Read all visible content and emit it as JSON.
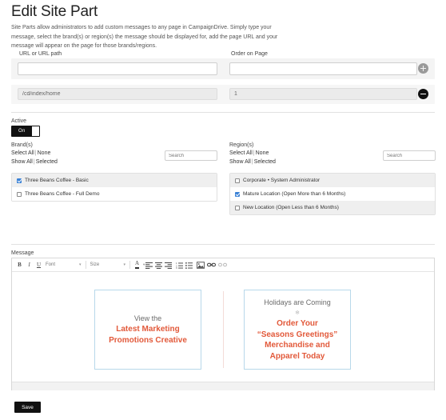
{
  "page": {
    "title": "Edit Site Part",
    "intro": "Site Parts allow administrators to add custom messages to any page in CampaignDrive. Simply type your message, select the brand(s) or region(s) the message should be displayed for, add the page URL and your message will appear on the page for those brands/regions."
  },
  "url_section": {
    "url_label": "URL or URL path",
    "order_label": "Order on Page",
    "new_row": {
      "url_value": "",
      "url_placeholder": "",
      "order_value": "",
      "order_placeholder": "",
      "add_icon": "plus-circle-icon"
    },
    "existing_row": {
      "url_value": "/cd/index/home",
      "order_value": "1",
      "remove_icon": "minus-circle-icon"
    }
  },
  "active": {
    "label": "Active",
    "state": "On"
  },
  "brands": {
    "title": "Brand(s)",
    "select_all": "Select All",
    "none": "None",
    "show_all": "Show All",
    "selected": "Selected",
    "separator": "|",
    "search_placeholder": "Search",
    "search_value": "",
    "items": [
      {
        "label": "Three Beans Coffee - Basic",
        "checked": true
      },
      {
        "label": "Three Beans Coffee - Full Demo",
        "checked": false
      }
    ]
  },
  "regions": {
    "title": "Region(s)",
    "select_all": "Select All",
    "none": "None",
    "show_all": "Show All",
    "selected": "Selected",
    "separator": "|",
    "search_placeholder": "Search",
    "search_value": "",
    "items": [
      {
        "label": "Corporate • System Administrator",
        "checked": false
      },
      {
        "label": "Mature Location (Open More than 6 Months)",
        "checked": true
      },
      {
        "label": "New Location (Open Less than 6 Months)",
        "checked": false
      }
    ]
  },
  "message": {
    "label": "Message",
    "toolbar": {
      "bold": "B",
      "italic": "I",
      "underline": "U",
      "font_label": "Font",
      "size_label": "Size",
      "caret": "▾",
      "text_color": "A",
      "icons": [
        "align-left-icon",
        "align-center-icon",
        "align-right-icon",
        "numbered-list-icon",
        "bullet-list-icon",
        "image-icon",
        "link-icon",
        "unlink-icon"
      ]
    },
    "cards": [
      {
        "sub": "View the",
        "main_line1": "Latest Marketing",
        "main_line2": "Promotions Creative"
      },
      {
        "sub": "Holidays are Coming",
        "snowflake": "❄",
        "main_line1": "Order Your",
        "main_line2": "“Seasons Greetings”",
        "main_line3": "Merchandise and",
        "main_line4": "Apparel Today"
      }
    ]
  },
  "footer": {
    "save_label": "Save"
  },
  "colors": {
    "accent_orange": "#e2593a",
    "checkbox_blue": "#3b82d6",
    "card_border": "#b8d8ea",
    "dark": "#111111"
  }
}
